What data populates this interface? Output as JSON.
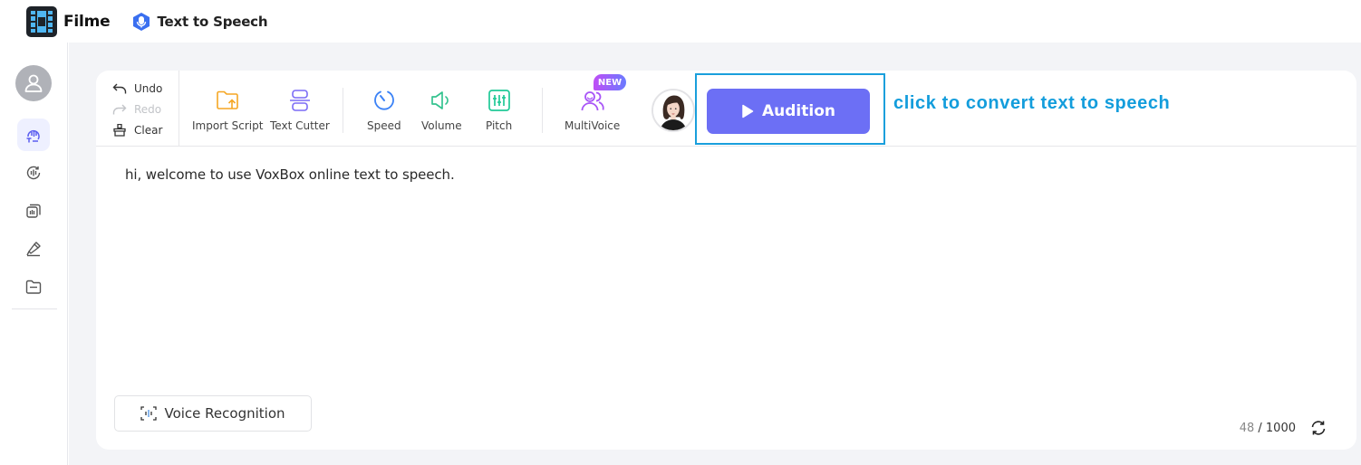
{
  "header": {
    "brand_name": "Filme",
    "app_name": "Text to Speech",
    "brand_icon": "film-logo-icon",
    "app_icon": "microphone-badge-icon"
  },
  "sidebar": {
    "avatar_icon": "user-avatar-icon",
    "items": [
      {
        "id": "text-to-speech",
        "icon": "speech-text-icon",
        "active": true
      },
      {
        "id": "voice-changer",
        "icon": "voice-cycle-icon",
        "active": false
      },
      {
        "id": "audio-files",
        "icon": "audio-stack-icon",
        "active": false
      },
      {
        "id": "recording",
        "icon": "microphone-pen-icon",
        "active": false
      },
      {
        "id": "files",
        "icon": "folder-icon",
        "active": false
      }
    ]
  },
  "toolbar": {
    "undo_label": "Undo",
    "redo_label": "Redo",
    "clear_label": "Clear",
    "import_script_label": "Import Script",
    "text_cutter_label": "Text Cutter",
    "speed_label": "Speed",
    "volume_label": "Volume",
    "pitch_label": "Pitch",
    "multivoice_label": "MultiVoice",
    "new_badge": "NEW",
    "audition_label": "Audition",
    "annotation": "click to convert text to speech"
  },
  "editor": {
    "text": "hi, welcome to use VoxBox online text to speech.",
    "voice_recognition_label": "Voice Recognition",
    "char_count": "48",
    "char_limit": "/ 1000"
  },
  "colors": {
    "accent": "#6c6ff5",
    "annotation": "#139ddc",
    "import_icon": "#f5a623",
    "cutter_icon": "#7b6cf6",
    "speed_icon": "#3b82f6",
    "volume_icon": "#34c38f",
    "pitch_icon": "#20c997",
    "multivoice_icon": "#a855f7"
  }
}
